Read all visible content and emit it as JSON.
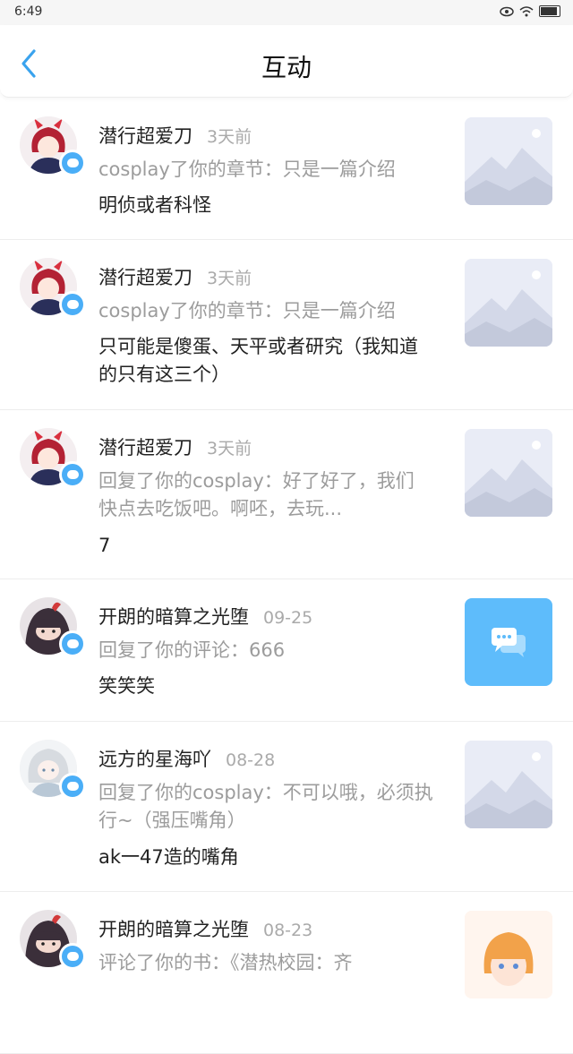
{
  "status_bar": {
    "time": "6:49"
  },
  "header": {
    "title": "互动"
  },
  "items": [
    {
      "name": "潜行超爱刀",
      "time": "3天前",
      "desc": "cosplay了你的章节：只是一篇介绍",
      "content": "明侦或者科怪",
      "thumb": "placeholder-image"
    },
    {
      "name": "潜行超爱刀",
      "time": "3天前",
      "desc": "cosplay了你的章节：只是一篇介绍",
      "content": "只可能是傻蛋、天平或者研究（我知道的只有这三个）",
      "thumb": "placeholder-image"
    },
    {
      "name": "潜行超爱刀",
      "time": "3天前",
      "desc": "回复了你的cosplay：好了好了，我们快点去吃饭吧。啊呸，去玩...",
      "content": "7",
      "thumb": "placeholder-image"
    },
    {
      "name": "开朗的暗算之光堕",
      "time": "09-25",
      "desc": "回复了你的评论：666",
      "content": "笑笑笑",
      "thumb": "comment-icon"
    },
    {
      "name": "远方的星海吖",
      "time": "08-28",
      "desc": "回复了你的cosplay：不可以哦，必须执行~（强压嘴角）",
      "content": "ak一47造的嘴角",
      "thumb": "placeholder-image"
    },
    {
      "name": "开朗的暗算之光堕",
      "time": "08-23",
      "desc": "评论了你的书：《潜热校园：齐",
      "content": "",
      "thumb": "anime-cover"
    }
  ],
  "colors": {
    "accent": "#4aaef7",
    "tile_blue": "#5ebcfb",
    "muted_text": "#9c9c9c"
  }
}
